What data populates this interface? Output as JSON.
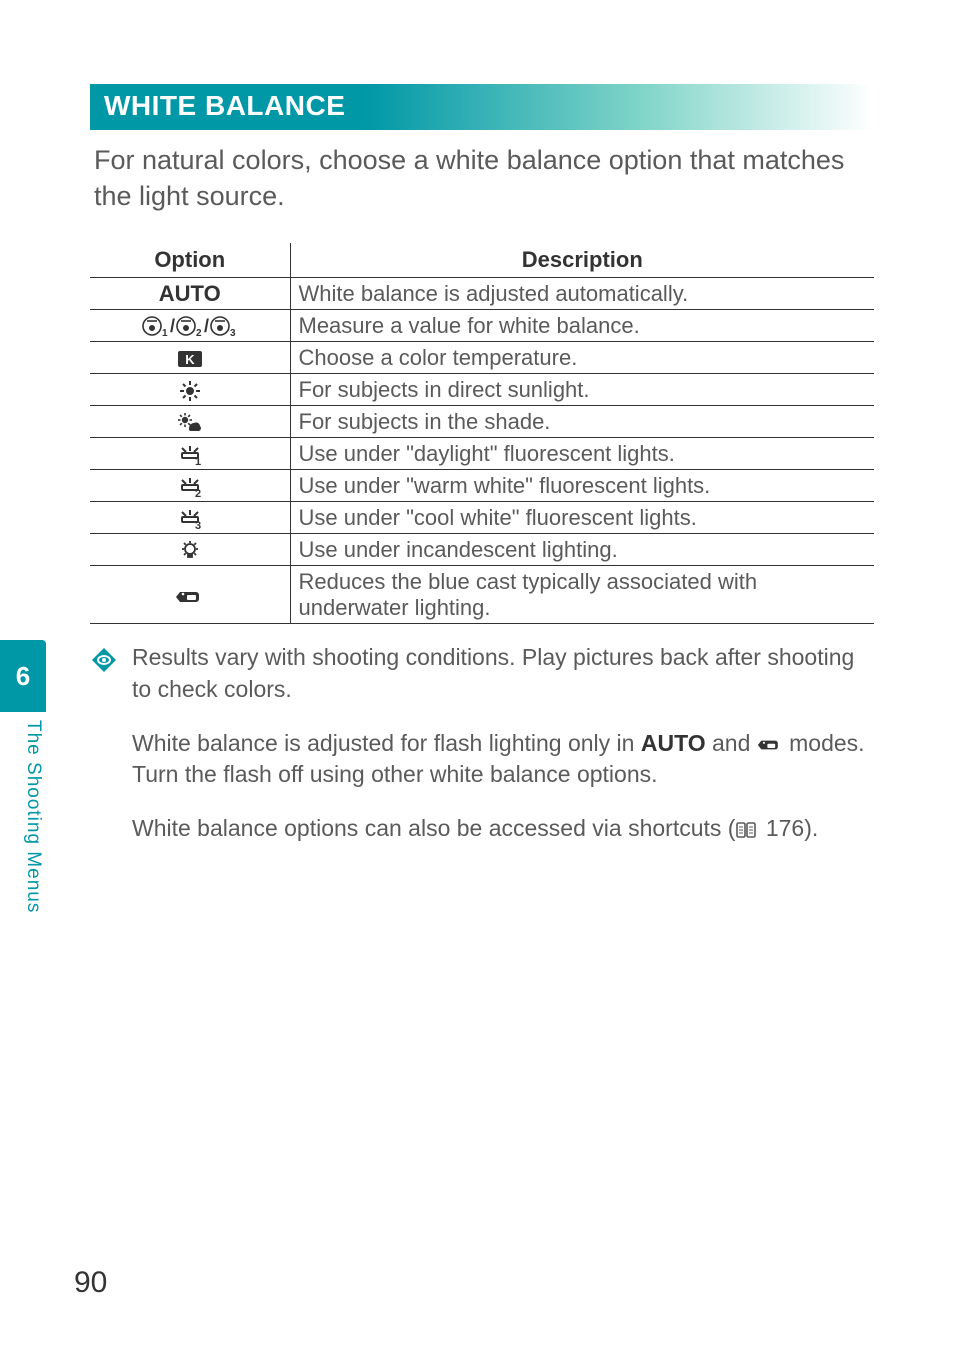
{
  "section_title": "WHITE BALANCE",
  "intro": "For natural colors, choose a white balance option that matches the light source.",
  "table": {
    "headers": {
      "option": "Option",
      "description": "Description"
    },
    "rows": [
      {
        "icon": "auto-text",
        "label": "AUTO",
        "desc": "White balance is adjusted automatically."
      },
      {
        "icon": "custom-preset",
        "label": "custom-preset-1-2-3",
        "desc": "Measure a value for white balance."
      },
      {
        "icon": "kelvin",
        "label": "K",
        "desc": "Choose a color temperature."
      },
      {
        "icon": "sun",
        "label": "direct-sunlight",
        "desc": "For subjects in direct sunlight."
      },
      {
        "icon": "shade",
        "label": "shade",
        "desc": "For subjects in the shade."
      },
      {
        "icon": "fluor1",
        "label": "fluorescent-1",
        "desc": "Use under \"daylight\" fluorescent lights."
      },
      {
        "icon": "fluor2",
        "label": "fluorescent-2",
        "desc": "Use under \"warm white\" fluorescent lights."
      },
      {
        "icon": "fluor3",
        "label": "fluorescent-3",
        "desc": "Use under \"cool white\" fluorescent lights."
      },
      {
        "icon": "incandescent",
        "label": "incandescent",
        "desc": "Use under incandescent lighting."
      },
      {
        "icon": "underwater",
        "label": "underwater",
        "desc": "Reduces the blue cast typically associated with underwater lighting."
      }
    ]
  },
  "notes": {
    "p1": "Results vary with shooting conditions.  Play pictures back after shooting to check colors.",
    "p2a": "White balance is adjusted for flash lighting only in ",
    "p2_auto": "AUTO",
    "p2b": " and ",
    "p2c": " modes. Turn the flash off using other white balance options.",
    "p3a": "White balance options can also be accessed via shortcuts (",
    "p3_ref": " 176).",
    "p3_pagenum": "176"
  },
  "side": {
    "chapter": "6",
    "label": "The Shooting Menus"
  },
  "page_number": "90"
}
